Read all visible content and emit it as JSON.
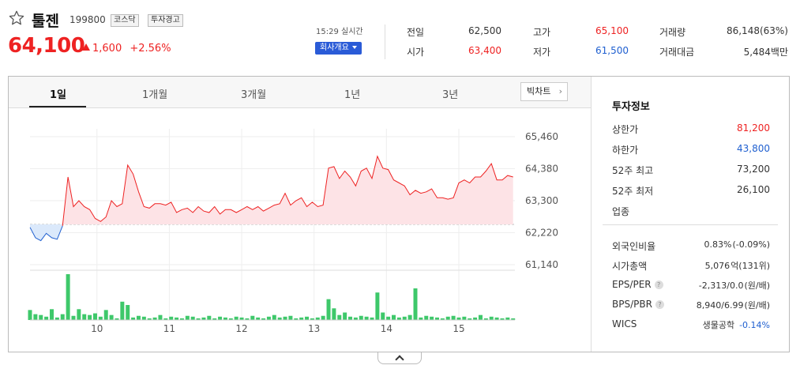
{
  "stock": {
    "name": "툴젠",
    "code": "199800",
    "market_badge": "코스닥",
    "warning_badge": "투자경고",
    "price": "64,100",
    "change_abs": "1,600",
    "change_pct": "+2.56%"
  },
  "realtime": {
    "time": "15:29 실시간",
    "company_button": "회사개요"
  },
  "stats": [
    {
      "label": "전일",
      "value": "62,500",
      "tone": "dark"
    },
    {
      "label": "시가",
      "value": "63,400",
      "tone": "red"
    },
    {
      "label": "고가",
      "value": "65,100",
      "tone": "red"
    },
    {
      "label": "저가",
      "value": "61,500",
      "tone": "blue"
    },
    {
      "label": "거래량",
      "value": "86,148(63%)",
      "tone": "dark"
    },
    {
      "label": "거래대금",
      "value": "5,484백만",
      "tone": "dark"
    }
  ],
  "tabs": [
    "1일",
    "1개월",
    "3개월",
    "1년",
    "3년"
  ],
  "active_tab": "1일",
  "big_chart_button": "빅차트",
  "info": {
    "title": "투자정보",
    "rows": [
      {
        "label": "상한가",
        "value": "81,200",
        "tone": "red"
      },
      {
        "label": "하한가",
        "value": "43,800",
        "tone": "blue"
      },
      {
        "label": "52주 최고",
        "value": "73,200",
        "tone": "dark"
      },
      {
        "label": "52주 최저",
        "value": "26,100",
        "tone": "dark"
      },
      {
        "label": "업종",
        "value": "",
        "tone": "dark"
      }
    ],
    "rows2": [
      {
        "label": "외국인비율",
        "value": "0.83%",
        "sub": "(-0.09%)",
        "help": false,
        "tone": "dark"
      },
      {
        "label": "시가총액",
        "value": "5,076",
        "sub": "억(131위)",
        "help": false,
        "tone": "dark"
      },
      {
        "label": "EPS/PER",
        "value": "-2,313/0.0",
        "sub": "(원/배)",
        "help": true,
        "tone": "dark"
      },
      {
        "label": "BPS/PBR",
        "value": "8,940/6.99",
        "sub": "(원/배)",
        "help": true,
        "tone": "dark"
      },
      {
        "label": "WICS",
        "value": "생물공학",
        "sub": "-0.14%",
        "help": false,
        "tone": "dark"
      }
    ]
  },
  "colors": {
    "up": "#ee2222",
    "down": "#2060d0",
    "up_fill": "#fde3e6",
    "down_fill": "#dbe9fb",
    "volume": "#3ec86a"
  },
  "chart_data": {
    "type": "line",
    "title": "",
    "price_axis_ticks": [
      "65,460",
      "64,380",
      "63,300",
      "62,220",
      "61,140"
    ],
    "price_axis_values": [
      65460,
      64380,
      63300,
      62220,
      61140
    ],
    "ylim": [
      61140,
      65460
    ],
    "x_tick_labels": [
      "10",
      "11",
      "12",
      "13",
      "14",
      "15"
    ],
    "x_tick_positions": [
      3.7,
      7.7,
      11.7,
      15.7,
      19.7,
      23.7
    ],
    "baseline": 62500,
    "x": [
      0,
      0.3,
      0.6,
      0.9,
      1.2,
      1.5,
      1.8,
      2.1,
      2.4,
      2.7,
      3.0,
      3.3,
      3.6,
      3.9,
      4.2,
      4.5,
      4.8,
      5.1,
      5.4,
      5.7,
      6.0,
      6.3,
      6.6,
      6.9,
      7.2,
      7.5,
      7.8,
      8.1,
      8.4,
      8.7,
      9.0,
      9.3,
      9.6,
      9.9,
      10.2,
      10.5,
      10.8,
      11.1,
      11.4,
      11.7,
      12.0,
      12.3,
      12.6,
      12.9,
      13.2,
      13.5,
      13.8,
      14.1,
      14.4,
      14.7,
      15.0,
      15.3,
      15.6,
      15.9,
      16.2,
      16.5,
      16.8,
      17.1,
      17.4,
      17.7,
      18.0,
      18.3,
      18.6,
      18.9,
      19.2,
      19.5,
      19.8,
      20.1,
      20.4,
      20.7,
      21.0,
      21.3,
      21.6,
      21.9,
      22.2,
      22.5,
      22.8,
      23.1,
      23.4,
      23.7,
      24.0,
      24.3,
      24.6,
      24.9,
      25.2,
      25.5,
      25.8,
      26.1,
      26.4,
      26.7
    ],
    "y": [
      62400,
      62050,
      61950,
      62200,
      62050,
      62000,
      62450,
      64100,
      63100,
      63300,
      63100,
      63000,
      62700,
      62600,
      62750,
      63300,
      63100,
      63200,
      64500,
      64200,
      63600,
      63100,
      63050,
      63200,
      63200,
      63150,
      63250,
      62900,
      63000,
      63050,
      62900,
      63100,
      62950,
      62900,
      63100,
      62850,
      63000,
      63000,
      62900,
      63000,
      63100,
      63000,
      63100,
      62950,
      63050,
      63150,
      63200,
      63550,
      63150,
      63300,
      63400,
      63100,
      63250,
      63100,
      63150,
      64400,
      64450,
      64050,
      64300,
      64100,
      63800,
      64300,
      64400,
      64050,
      64800,
      64400,
      64350,
      64000,
      63900,
      63800,
      63500,
      63650,
      63550,
      63600,
      63700,
      63400,
      63400,
      63350,
      63400,
      63900,
      64000,
      63900,
      64100,
      64100,
      64300,
      64550,
      64000,
      64000,
      64150,
      64100
    ],
    "volume": [
      12,
      7,
      6,
      4,
      13,
      3,
      7,
      55,
      5,
      13,
      7,
      6,
      8,
      4,
      12,
      6,
      2,
      22,
      18,
      3,
      5,
      4,
      2,
      3,
      6,
      2,
      4,
      3,
      2,
      5,
      4,
      2,
      3,
      5,
      2,
      4,
      3,
      2,
      4,
      3,
      2,
      5,
      3,
      2,
      4,
      6,
      3,
      4,
      5,
      2,
      3,
      4,
      2,
      3,
      5,
      25,
      14,
      6,
      9,
      4,
      3,
      5,
      4,
      3,
      33,
      9,
      4,
      6,
      3,
      4,
      6,
      38,
      3,
      5,
      4,
      3,
      2,
      4,
      5,
      3,
      4,
      2,
      3,
      6,
      2,
      4,
      3,
      2,
      3,
      2
    ]
  }
}
